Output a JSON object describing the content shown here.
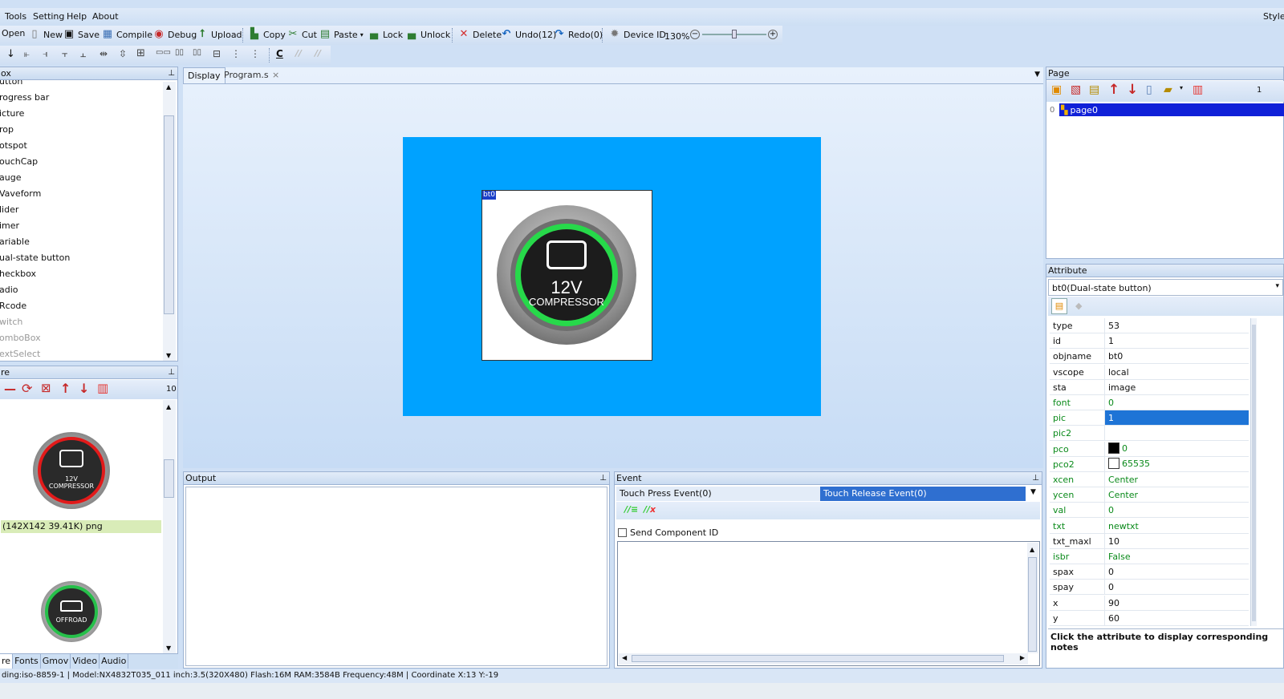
{
  "menu": {
    "tools": "Tools",
    "setting": "Setting",
    "help": "Help",
    "about": "About",
    "style": "Style"
  },
  "toolbar1": {
    "open": "Open",
    "new": "New",
    "save": "Save",
    "compile": "Compile",
    "debug": "Debug",
    "upload": "Upload",
    "copy": "Copy",
    "cut": "Cut",
    "paste": "Paste",
    "lock": "Lock",
    "unlock": "Unlock",
    "delete": "Delete",
    "undo": "Undo(12)",
    "redo": "Redo(0)",
    "device_id": "Device ID",
    "zoom": "130%"
  },
  "toolbox": {
    "title": "ox",
    "items": [
      "utton",
      "rogress bar",
      "icture",
      "rop",
      "otspot",
      "ouchCap",
      "auge",
      "Vaveform",
      "lider",
      "imer",
      "ariable",
      "ual-state button",
      "heckbox",
      "adio",
      "Rcode",
      "witch",
      "omboBox",
      "extSelect"
    ],
    "disabled_from": 15
  },
  "picture_panel": {
    "title": "re",
    "count": "10",
    "item1_label": "12V\nCOMPRESSOR",
    "item1_info": "(142X142 39.41K) png",
    "item2_label": "OFFROAD"
  },
  "bottom_tabs": [
    "re",
    "Fonts",
    "Gmov",
    "Video",
    "Audio"
  ],
  "display_tabs": {
    "display": "Display",
    "program": "Program.s",
    "close": "×"
  },
  "canvas": {
    "bg_color": "#00a2ff",
    "component_label": "bt0",
    "button_text_1": "12V",
    "button_text_2": "COMPRESSOR"
  },
  "output": {
    "title": "Output"
  },
  "event": {
    "title": "Event",
    "tab_press": "Touch Press Event(0)",
    "tab_release": "Touch Release Event(0)",
    "send_id": "Send Component ID"
  },
  "page": {
    "title": "Page",
    "count": "1",
    "row_index": "0",
    "row_name": "page0"
  },
  "attribute": {
    "title": "Attribute",
    "selector": "bt0(Dual-state button)",
    "note": "Click the attribute to display corresponding notes",
    "rows": [
      {
        "k": "type",
        "v": "53",
        "g": false
      },
      {
        "k": "id",
        "v": "1",
        "g": false
      },
      {
        "k": "objname",
        "v": "bt0",
        "g": false
      },
      {
        "k": "vscope",
        "v": "local",
        "g": false
      },
      {
        "k": "sta",
        "v": "image",
        "g": false
      },
      {
        "k": "font",
        "v": "0",
        "g": true
      },
      {
        "k": "pic",
        "v": "1",
        "g": true
      },
      {
        "k": "pic2",
        "v": "",
        "g": true
      },
      {
        "k": "pco",
        "v": "0",
        "g": true
      },
      {
        "k": "pco2",
        "v": "65535",
        "g": true
      },
      {
        "k": "xcen",
        "v": "Center",
        "g": true
      },
      {
        "k": "ycen",
        "v": "Center",
        "g": true
      },
      {
        "k": "val",
        "v": "0",
        "g": true
      },
      {
        "k": "txt",
        "v": "newtxt",
        "g": true
      },
      {
        "k": "txt_maxl",
        "v": "10",
        "g": false
      },
      {
        "k": "isbr",
        "v": "False",
        "g": true
      },
      {
        "k": "spax",
        "v": "0",
        "g": false
      },
      {
        "k": "spay",
        "v": "0",
        "g": false
      },
      {
        "k": "x",
        "v": "90",
        "g": false
      },
      {
        "k": "y",
        "v": "60",
        "g": false
      }
    ]
  },
  "statusbar": {
    "text": "ding:iso-8859-1 | Model:NX4832T035_011 inch:3.5(320X480) Flash:16M RAM:3584B Frequency:48M |    Coordinate X:13  Y:-19"
  }
}
